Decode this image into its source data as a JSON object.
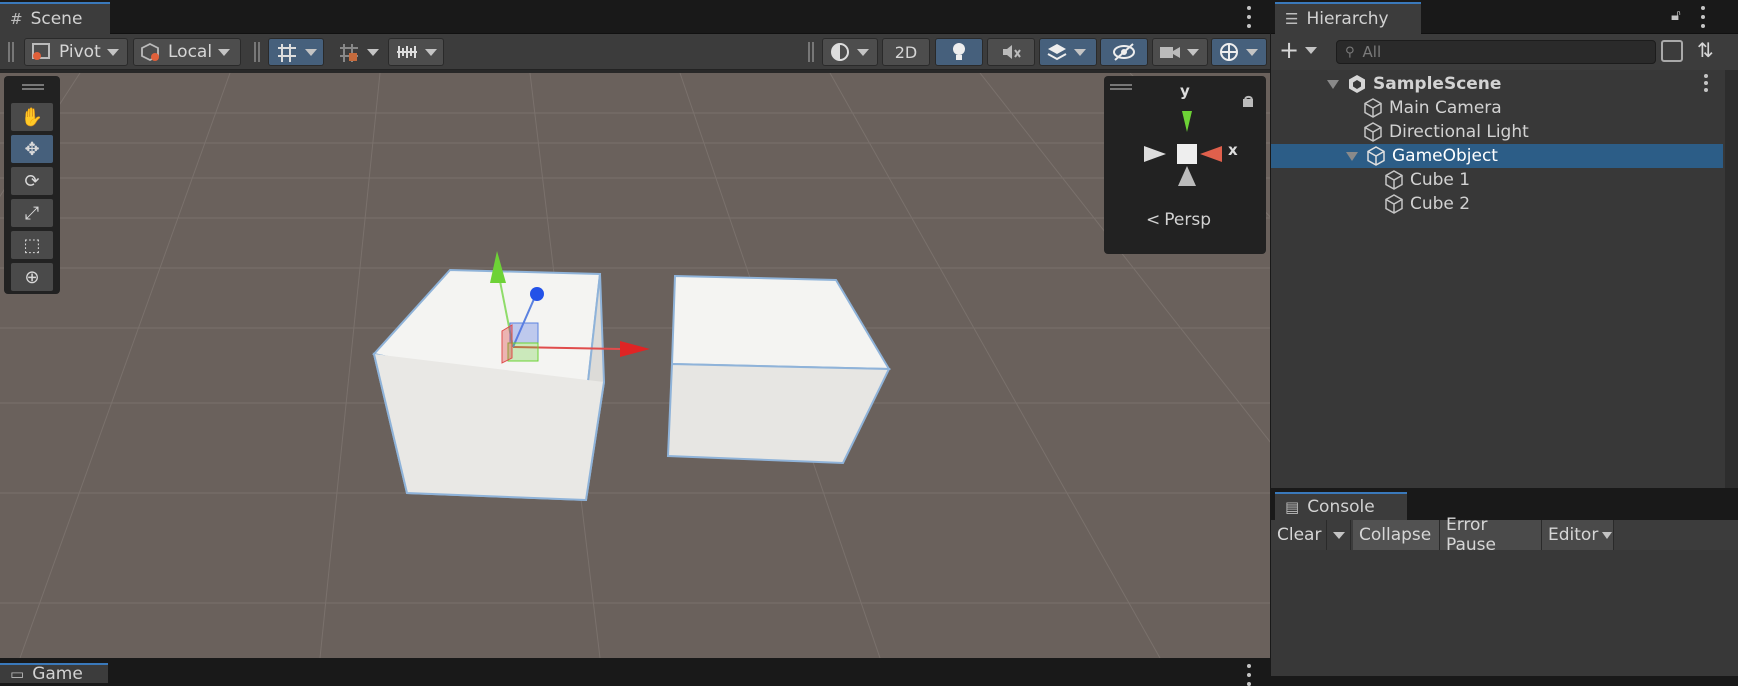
{
  "scene": {
    "tab_label": "Scene",
    "tab_icon": "grid-hash-icon",
    "pivot_label": "Pivot",
    "local_label": "Local",
    "mode_2d_label": "2D",
    "persp_label": "Persp",
    "axis_y_label": "y",
    "axis_x_label": "x"
  },
  "game": {
    "tab_label": "Game"
  },
  "hierarchy": {
    "tab_label": "Hierarchy",
    "search_placeholder": "All",
    "scene_name": "SampleScene",
    "items": [
      {
        "label": "Main Camera"
      },
      {
        "label": "Directional Light"
      },
      {
        "label": "GameObject"
      },
      {
        "label": "Cube 1"
      },
      {
        "label": "Cube 2"
      }
    ]
  },
  "console": {
    "tab_label": "Console",
    "clear_label": "Clear",
    "collapse_label": "Collapse",
    "error_pause_label": "Error Pause",
    "editor_label": "Editor"
  },
  "colors": {
    "selection": "#2c5d87",
    "active_tool": "#46607c",
    "tab_highlight": "#3a79bb",
    "viewport_bg": "#6a615c"
  }
}
